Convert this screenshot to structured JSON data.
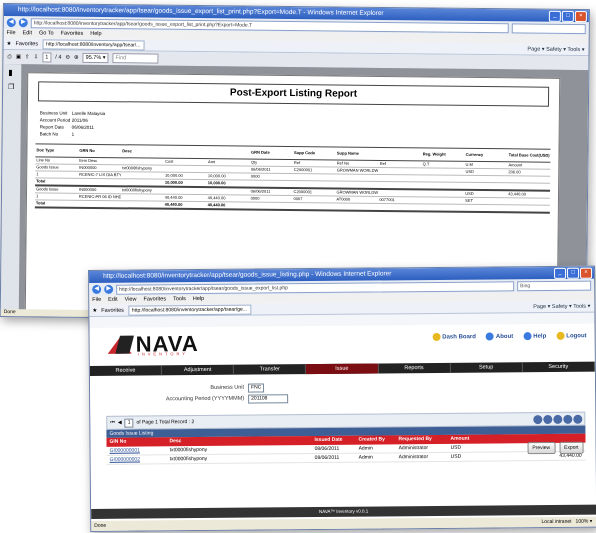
{
  "back_window": {
    "title": "http://localhost:8080/inventorytracker/app/tsear/goods_issue_export_list_print.php?Export=Mode.T - Windows Internet Explorer",
    "url": "http://localhost:8080/inventorytracker/app/tsear/goods_issue_export_list_print.php?Export=Mode.T",
    "menu": [
      "File",
      "Edit",
      "Go To",
      "Favorites",
      "Help"
    ],
    "fav_label": "Favorites",
    "fav_tab": "http://localhost:8080/inventory/app/tsear/...",
    "fav_tools": "Page ▾  Safety ▾  Tools ▾",
    "pdf_page": "1",
    "pdf_page_total": "/ 4",
    "pdf_zoom": "95.7% ▾",
    "pdf_find": "Find",
    "report": {
      "title": "Post-Export Listing Report",
      "meta": [
        {
          "k": "Business Unit",
          "v": "Lavelle Malaysia"
        },
        {
          "k": "Account Period",
          "v": "2011/06"
        },
        {
          "k": "Report Date",
          "v": "06/06/2011"
        },
        {
          "k": "Batch No",
          "v": "1"
        }
      ],
      "headers": [
        "Doc Type",
        "GRN No",
        "Desc",
        "",
        "",
        "GRN Date",
        "Supp Code",
        "Supp Name",
        "",
        "Reg. Weight",
        "Currency",
        "Total Base Cost(USD)"
      ],
      "subheaders": [
        "Line No",
        "Item Desc",
        "",
        "Cost",
        "Amt",
        "Qty",
        "Ref",
        "Ref No",
        "Ref",
        "Q.T",
        "U.M",
        "Amount"
      ],
      "groups": [
        {
          "head": [
            "Goods Issue",
            "IN000000",
            "txt0000fishypony",
            "",
            "",
            "06/06/2011",
            "C2000001",
            "GROWMAN WORLDWIDE IND SDN BHD",
            "",
            "",
            "USD",
            "206.00"
          ],
          "line": [
            "1",
            "RCENIC-7 LIX DIA BTY RIC 99",
            "",
            "10,000.00",
            "10,000.00",
            "0000",
            "",
            "",
            "",
            "",
            "",
            ""
          ],
          "total": [
            "Total",
            "",
            "",
            "10,000.00",
            "10,000.00",
            "",
            "",
            "",
            "",
            "",
            "",
            ""
          ]
        },
        {
          "head": [
            "Goods Issue",
            "IN000000",
            "txt0000fishypony",
            "",
            "",
            "06/06/2011",
            "C2000001",
            "GROWMAN WORLDWIDE IND SDN BHD",
            "",
            "",
            "USD",
            "43,440.00"
          ],
          "line": [
            "1",
            "RCENIC-PR 06 ID NHD G 40 LI GBIOR.4",
            "",
            "40,440.00",
            "40,440.00",
            "0000",
            "0007",
            "AT0000",
            "0077001",
            "",
            "SET",
            ""
          ],
          "total": [
            "Total",
            "",
            "",
            "40,440.00",
            "40,440.00",
            "",
            "",
            "",
            "",
            "",
            "",
            ""
          ]
        }
      ]
    },
    "status": "Done"
  },
  "front_window": {
    "title": "http://localhost:8080/inventorytracker/app/tsear/goods_issue_listing.php - Windows Internet Explorer",
    "url": "http://localhost:8080/inventorytracker/app/tsear/goods_issue_export_list.php",
    "search_placeholder": "Bing",
    "menu": [
      "File",
      "Edit",
      "View",
      "Favorites",
      "Tools",
      "Help"
    ],
    "fav_label": "Favorites",
    "fav_tab": "http://localhost:8080/inventorytracker/app/tsear/ge...",
    "fav_tools": "Page ▾  Safety ▾  Tools ▾",
    "logo": {
      "name": "NAVA",
      "sub": "INVENTORY"
    },
    "top_links": [
      "Dash Board",
      "About",
      "Help",
      "Logout"
    ],
    "nav": [
      "Receive",
      "Adjustment",
      "Transfer",
      "Issue",
      "Reports",
      "Setup",
      "Security"
    ],
    "nav_active": "Issue",
    "form": {
      "business_unit_label": "Business Unit",
      "business_unit_value": "FNC",
      "accounting_period_label": "Accounting Period (YYYYMMM)",
      "accounting_period_value": "201108"
    },
    "pager": {
      "page": "1",
      "text": "of Page 1 Total Record : 2"
    },
    "grid_title": "Goods Issue Listing",
    "columns": [
      "GIN No",
      "Desc",
      "Issued Date",
      "Created By",
      "Requested By",
      "Amount"
    ],
    "rows": [
      {
        "gin": "GI000000001",
        "desc": "txt0000fishypony",
        "date": "08/06/2011",
        "created": "Admin",
        "requested": "Administrator",
        "currency": "USD",
        "amount": "200.00"
      },
      {
        "gin": "GI000000002",
        "desc": "txt0000fishypony",
        "date": "08/06/2011",
        "created": "Admin",
        "requested": "Administrator",
        "currency": "USD",
        "amount": "43,440.00"
      }
    ],
    "buttons": {
      "preview": "Preview",
      "export": "Export"
    },
    "footer": "NAVA™ Inventory v0.0.1",
    "status_left": "Done",
    "status_zone": "Local intranet",
    "status_zoom": "100% ▾"
  }
}
